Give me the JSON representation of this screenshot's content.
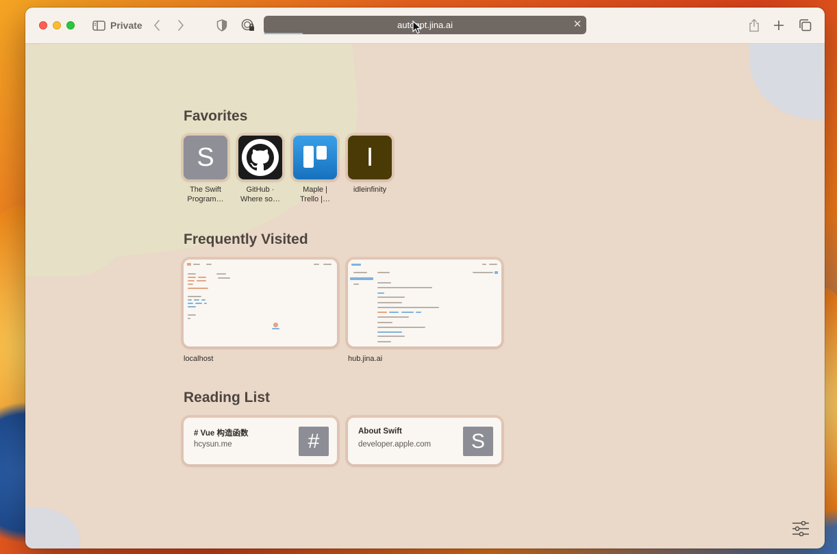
{
  "toolbar": {
    "private_label": "Private",
    "address": "autogpt.jina.ai",
    "address_clear_icon": "close-icon"
  },
  "favorites": {
    "title": "Favorites",
    "items": [
      {
        "label1": "The Swift",
        "label2": "Program…",
        "tile_text": "S",
        "color": "#8f8f97"
      },
      {
        "label1": "GitHub ·",
        "label2": "Where so…",
        "tile_text": "",
        "color": "#1b1b1b"
      },
      {
        "label1": "Maple |",
        "label2": "Trello |…",
        "tile_text": "",
        "color": "#1f7fd0"
      },
      {
        "label1": "idleinfinity",
        "label2": "",
        "tile_text": "I",
        "color": "#4a3a05"
      }
    ]
  },
  "frequently_visited": {
    "title": "Frequently Visited",
    "items": [
      {
        "label": "localhost"
      },
      {
        "label": "hub.jina.ai"
      }
    ]
  },
  "reading_list": {
    "title": "Reading List",
    "items": [
      {
        "title": "# Vue 构造函数",
        "domain": "hcysun.me",
        "icon_text": "#"
      },
      {
        "title": "About Swift",
        "domain": "developer.apple.com",
        "icon_text": "S"
      }
    ]
  }
}
